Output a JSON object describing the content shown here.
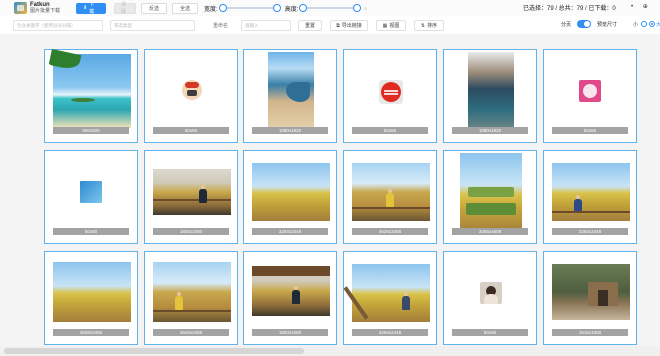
{
  "app": {
    "name": "Fatkun",
    "subtitle": "图片批量下载"
  },
  "toolbar": {
    "download_label": "下载",
    "download_icon": "download-icon",
    "b2_label": "清除",
    "invert_label": "反选",
    "select_all_label": "全选",
    "width_label": "宽度:",
    "height_label": "高度:",
    "width_slider": {
      "value": 0
    },
    "height_slider": {
      "value": 0
    },
    "range_min": "0",
    "range_max": "2",
    "stats": "已选择：79 / 总共：79 / 已下载：0",
    "window_buttons": [
      "•",
      "⊕"
    ]
  },
  "filters": {
    "url_placeholder": "包含关键字（使用逗号分隔）",
    "type_placeholder": "筛选类型",
    "rename_label": "重命名",
    "rename_placeholder": "请输入",
    "reset_label": "重置",
    "export_label": "导出链接",
    "view_label": "视图",
    "sort_label": "排序",
    "paging_label": "分页",
    "preview_label": "预览尺寸",
    "size_small": "小",
    "size_big": "大",
    "accent": "#2f8ff4"
  },
  "grid": {
    "rows": [
      [
        {
          "size": "500x500",
          "kind": "beach"
        },
        {
          "size": "50x50",
          "kind": "icon-small"
        },
        {
          "size": "1080x1920",
          "kind": "coast-tall"
        },
        {
          "size": "50x50",
          "kind": "red-badge"
        },
        {
          "size": "1080x1920",
          "kind": "lake-tall"
        },
        {
          "size": "50x50",
          "kind": "pink-avatar"
        }
      ],
      [
        {
          "size": "50x50",
          "kind": "tiny"
        },
        {
          "size": "1920x1080",
          "kind": "field-person"
        },
        {
          "size": "3264x2448",
          "kind": "field"
        },
        {
          "size": "4626x3456",
          "kind": "field-hands"
        },
        {
          "size": "3456x4608",
          "kind": "field-text"
        },
        {
          "size": "3264x2448",
          "kind": "field-sit"
        }
      ],
      [
        {
          "size": "4608x3456",
          "kind": "field"
        },
        {
          "size": "4626x3456",
          "kind": "field-person2"
        },
        {
          "size": "1920x1080",
          "kind": "hut"
        },
        {
          "size": "3264x2448",
          "kind": "field-sit2"
        },
        {
          "size": "50x50",
          "kind": "avatar"
        },
        {
          "size": "1616x1080",
          "kind": "house"
        }
      ]
    ],
    "border_color": "#5fb2ea"
  }
}
